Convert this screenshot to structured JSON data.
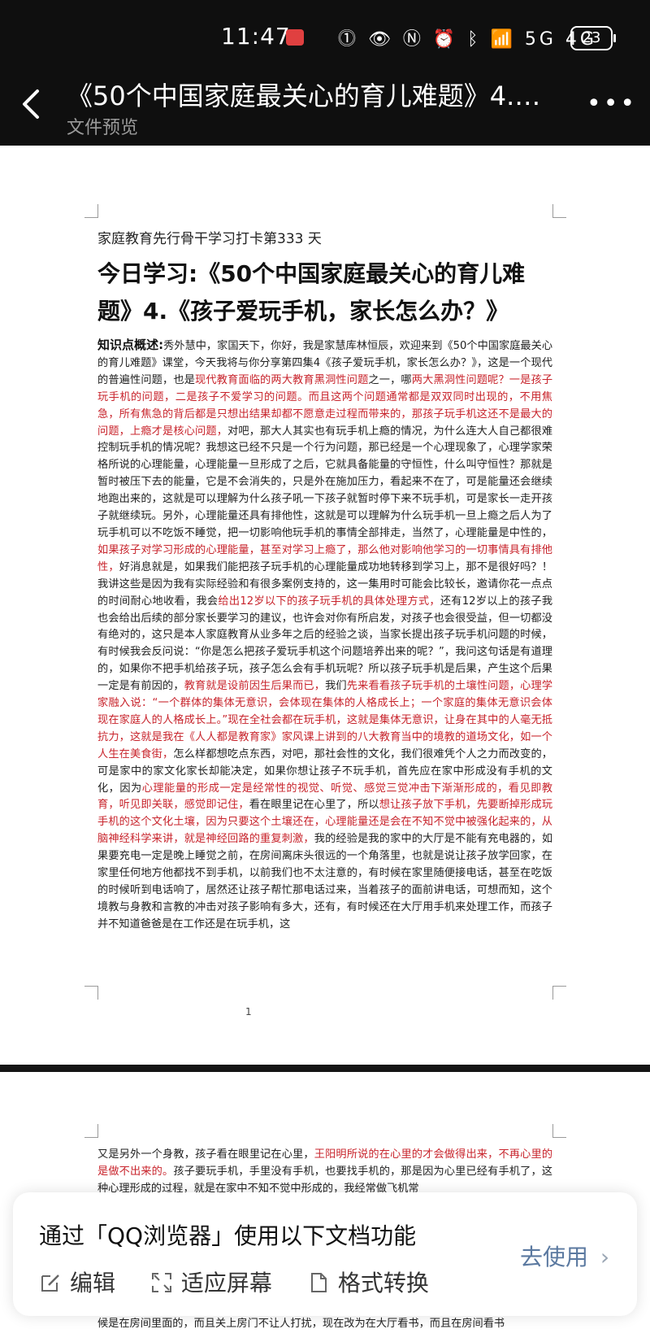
{
  "status_bar": {
    "time": "11:47",
    "icons_text": "⓵ 👁 Ⓝ ⏰ ᛒ 📶 5G 4G",
    "battery": "23"
  },
  "header": {
    "title": "《50个中国家庭最关心的育儿难题》4.…",
    "subtitle": "文件预览",
    "more": "•••"
  },
  "page1": {
    "kicker": "家庭教育先行骨干学习打卡第333 天",
    "headline_1": "今日学习:《50个中国家庭最关心的育儿难",
    "headline_2": "题》4.《孩子爱玩手机，家长怎么办？》",
    "lead_label": "知识点概述:",
    "segments": [
      {
        "t": "秀外慧中，家国天下，你好，我是家慧库林恒辰，欢迎来到《50个中国家庭最关心的育儿难题》课堂，今天我将与你分享第四集4《孩子爱玩手机，家长怎么办？》，这是一个现代的普遍性问题，也是",
        "red": false
      },
      {
        "t": "现代教育面临的两大教育黑洞性问题",
        "red": true
      },
      {
        "t": "之一，哪",
        "red": false
      },
      {
        "t": "两大黑洞性问题呢？一是孩子玩手机的问题，二是孩子不爱学习的问题。而且这两个问题通常都是双双同时出现的，不用焦急，所有焦急的背后都是只想出结果却都不愿意走过程而带来的，那孩子玩手机这还不是最大的问题，上瘾才是核心问题，",
        "red": true
      },
      {
        "t": "对吧，那大人其实也有玩手机上瘾的情况，为什么连大人自己都很难控制玩手机的情况呢？我想这已经不只是一个行为问题，那已经是一个心理现象了，心理学家荣格所说的心理能量，心理能量一旦形成了之后，它就具备能量的守恒性，什么叫守恒性？那就是暂时被压下去的能量，它是不会消失的，只是外在施加压力，看起来不在了，可是能量还会继续地跑出来的，这就是可以理解为什么孩子吼一下孩子就暂时停下来不玩手机，可是家长一走开孩子就继续玩。另外，心理能量还具有排他性，这就是可以理解为什么玩手机一旦上瘾之后人为了玩手机可以不吃饭不睡觉，把一切影响他玩手机的事情全部排走，当然了，心理能量是中性的，",
        "red": false
      },
      {
        "t": "如果孩子对学习形成的心理能量，甚至对学习上瘾了，那么他对影响他学习的一切事情具有排他性，",
        "red": true
      },
      {
        "t": "好消息就是，如果我们能把孩子玩手机的心理能量成功地转移到学习上，那不是很好吗？！ 我讲这些是因为我有实际经验和有很多案例支持的，这一集用时可能会比较长，邀请你花一点点的时间耐心地收看，我会",
        "red": false
      },
      {
        "t": "给出12岁以下的孩子玩手机的具体处理方式，",
        "red": true
      },
      {
        "t": "还有12岁以上的孩子我也会给出后续的部分家长要学习的建议，也许会对你有所启发，对孩子也会很受益，但一切都没有绝对的，这只是本人家庭教育从业多年之后的经验之谈，当家长提出孩子玩手机问题的时候，有时候我会反问说：“你是怎么把孩子爱玩手机这个问题培养出来的呢？”，我问这句话是有道理的，如果你不把手机给孩子玩，孩子怎么会有手机玩呢？所以孩子玩手机是后果，产生这个后果一定是有前因的，",
        "red": false
      },
      {
        "t": "教育就是设前因生后果而已，",
        "red": true
      },
      {
        "t": "我们",
        "red": false
      },
      {
        "t": "先来看看孩子玩手机的土壤性问题，心理学家融入说：“一个群体的集体无意识，会体现在集体的人格成长上；一个家庭的集体无意识会体现在家庭人的人格成长上。”现在全社会都在玩手机，这就是集体无意识，让身在其中的人毫无抵抗力，这就是我在《人人都是教育家》家风课上讲到的八大教育当中的境教的道场文化，如一个人生在美食街，",
        "red": true
      },
      {
        "t": "怎么样都想吃点东西，对吧，那社会性的文化，我们很难凭个人之力而改变的，可是家中的家文化家长却能决定，如果你想让孩子不玩手机，首先应在家中形成没有手机的文化，因为",
        "red": false
      },
      {
        "t": "心理能量的形成一定是经常性的视觉、听觉、感觉三觉冲击下渐渐形成的，看见即教育，听见即关联，感觉即记住，",
        "red": true
      },
      {
        "t": "看在眼里记在心里了，所以",
        "red": false
      },
      {
        "t": "想让孩子放下手机，先要断掉形成玩手机的这个文化土壤，因为只要这个土壤还在，心理能量还是会在不知不觉中被强化起来的，从脑神经科学来讲，就是神经回路的重复刺激，",
        "red": true
      },
      {
        "t": "我的经验是我的家中的大厅是不能有充电器的，如果要充电一定是晚上睡觉之前，在房间离床头很远的一个角落里，也就是说让孩子放学回家，在家里任何地方他都找不到手机，以前我们也不太注意的，有时候在家里随便接电话，甚至在吃饭的时候听到电话响了，居然还让孩子帮忙那电话过来，当着孩子的面前讲电话，可想而知，这个境教与身教和言教的冲击对孩子影响有多大，还有，有时候还在大厅用手机来处理工作，而孩子并不知道爸爸是在工作还是在玩手机，这",
        "red": false
      }
    ],
    "page_number": "1"
  },
  "page2": {
    "segments": [
      {
        "t": "又是另外一个身教，孩子看在眼里记在心里，",
        "red": false
      },
      {
        "t": "王阳明所说的在心里的才会做得出来，不再心里的是做不出来的。",
        "red": true
      },
      {
        "t": "孩子要玩手机，手里没有手机，也要找手机的，那是因为心里已经有手机了，这种心理形成的过程，就是在家中不知不觉中形成的，我经常做飞机常",
        "red": false
      }
    ],
    "peek": "候是在房间里面的，而且关上房门不让人打扰，现在改为在大厅看书，而且在房间看书"
  },
  "bottom_card": {
    "title": "通过「QQ浏览器」使用以下文档功能",
    "actions": [
      {
        "label": "编辑",
        "icon": "edit-icon"
      },
      {
        "label": "适应屏幕",
        "icon": "fit-screen-icon"
      },
      {
        "label": "格式转换",
        "icon": "file-convert-icon"
      }
    ],
    "use_label": "去使用",
    "use_chevron": "›"
  },
  "colors": {
    "header_bg": "#0f0f0f",
    "highlight_red": "#c8242c",
    "link_blue": "#5b79a0"
  }
}
